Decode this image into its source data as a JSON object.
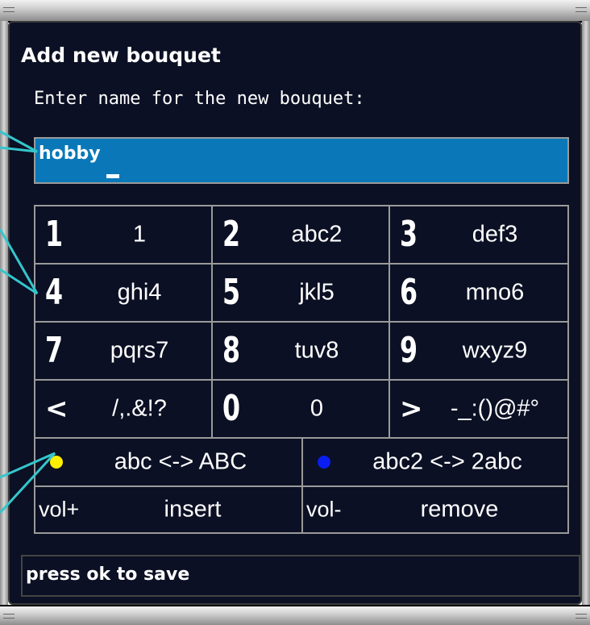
{
  "dialog": {
    "title": "Add new bouquet",
    "prompt": "Enter name for the new bouquet:",
    "input_value": "hobby"
  },
  "keypad": {
    "rows": [
      [
        {
          "big": "1",
          "chars": "1"
        },
        {
          "big": "2",
          "chars": "abc2"
        },
        {
          "big": "3",
          "chars": "def3"
        }
      ],
      [
        {
          "big": "4",
          "chars": "ghi4"
        },
        {
          "big": "5",
          "chars": "jkl5"
        },
        {
          "big": "6",
          "chars": "mno6"
        }
      ],
      [
        {
          "big": "7",
          "chars": "pqrs7"
        },
        {
          "big": "8",
          "chars": "tuv8"
        },
        {
          "big": "9",
          "chars": "wxyz9"
        }
      ],
      [
        {
          "big": "<",
          "chars": "/,.&!?"
        },
        {
          "big": "0",
          "chars": "0"
        },
        {
          "big": ">",
          "chars": "-_:()@#°"
        }
      ]
    ],
    "yellow": {
      "label": "abc <-> ABC",
      "color": "#ffee00"
    },
    "blue": {
      "label": "abc2 <-> 2abc",
      "color": "#0a1ef0"
    },
    "vol_plus": {
      "key": "vol+",
      "action": "insert"
    },
    "vol_minus": {
      "key": "vol-",
      "action": "remove"
    }
  },
  "status": "press ok to save",
  "colors": {
    "background": "#0b1024",
    "input_bg": "#0a78b8",
    "grid": "#9a9a9a",
    "callout": "#34c6cc"
  }
}
